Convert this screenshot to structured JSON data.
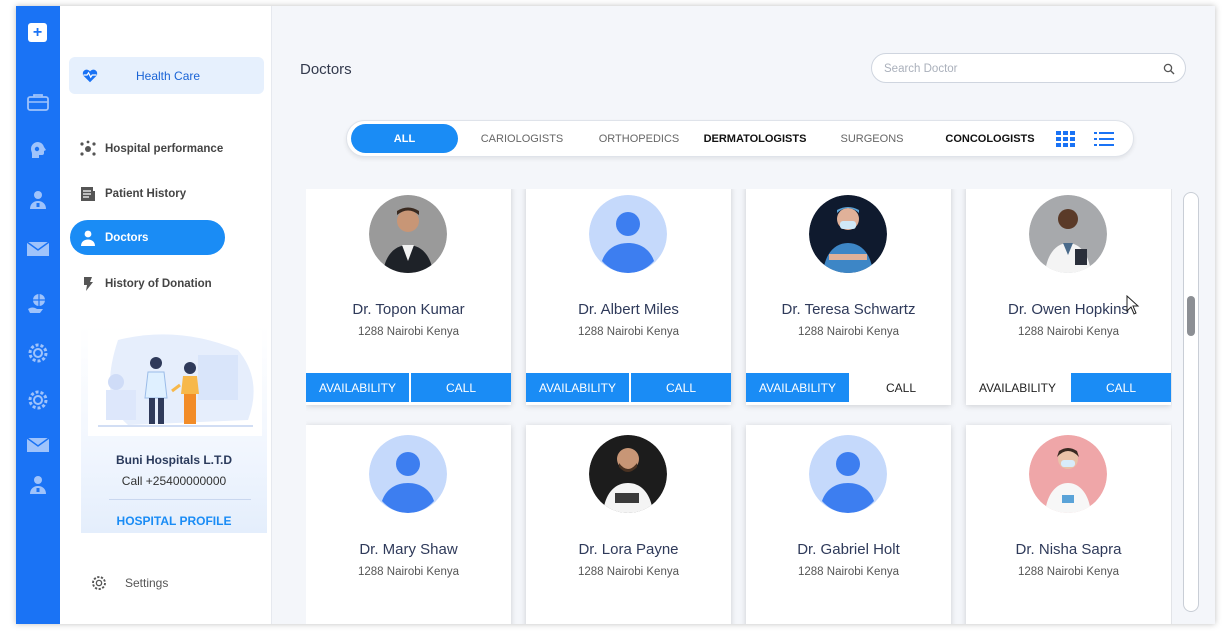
{
  "sidebar": {
    "brand": "Health Care",
    "items": [
      {
        "label": "Hospital performance",
        "icon": "network-icon"
      },
      {
        "label": "Patient History",
        "icon": "document-icon"
      },
      {
        "label": "Doctors",
        "icon": "doctor-icon",
        "active": true
      },
      {
        "label": "History of Donation",
        "icon": "donation-icon"
      }
    ],
    "hospital": {
      "name": "Buni Hospitals L.T.D",
      "phone": "Call +25400000000",
      "profile_link": "HOSPITAL PROFILE"
    },
    "settings_label": "Settings"
  },
  "header": {
    "title": "Doctors",
    "search_placeholder": "Search Doctor"
  },
  "filters": [
    {
      "label": "ALL",
      "active": true
    },
    {
      "label": "CARIOLOGISTS"
    },
    {
      "label": "ORTHOPEDICS"
    },
    {
      "label": "DERMATOLOGISTS",
      "emphasis": true
    },
    {
      "label": "SURGEONS"
    },
    {
      "label": "CONCOLOGISTS",
      "emphasis": true
    }
  ],
  "doctors": [
    {
      "name": "Dr. Topon Kumar",
      "location": "1288 Nairobi Kenya",
      "avatar": "photo-suit",
      "availability": "AVAILABILITY",
      "call": "CALL",
      "availability_active": true,
      "call_active": true
    },
    {
      "name": "Dr. Albert Miles",
      "location": "1288 Nairobi Kenya",
      "avatar": "placeholder",
      "availability": "AVAILABILITY",
      "call": "CALL",
      "availability_active": true,
      "call_active": true
    },
    {
      "name": "Dr. Teresa Schwartz",
      "location": "1288 Nairobi Kenya",
      "avatar": "photo-scrubs",
      "availability": "AVAILABILITY",
      "call": "CALL",
      "availability_active": true,
      "call_active": false
    },
    {
      "name": "Dr. Owen Hopkins",
      "location": "1288 Nairobi Kenya",
      "avatar": "photo-coat",
      "availability": "AVAILABILITY",
      "call": "CALL",
      "availability_active": false,
      "call_active": true
    },
    {
      "name": "Dr. Mary Shaw",
      "location": "1288 Nairobi Kenya",
      "avatar": "placeholder"
    },
    {
      "name": "Dr. Lora Payne",
      "location": "1288 Nairobi Kenya",
      "avatar": "photo-beard"
    },
    {
      "name": "Dr. Gabriel Holt",
      "location": "1288 Nairobi Kenya",
      "avatar": "placeholder"
    },
    {
      "name": "Dr. Nisha Sapra",
      "location": "1288 Nairobi Kenya",
      "avatar": "photo-mask-pink"
    }
  ],
  "colors": {
    "primary": "#1a8cf5",
    "rail": "#1a73f5",
    "avatar_placeholder_bg": "#c5d9fb",
    "avatar_placeholder_fg": "#3d7ef0"
  }
}
